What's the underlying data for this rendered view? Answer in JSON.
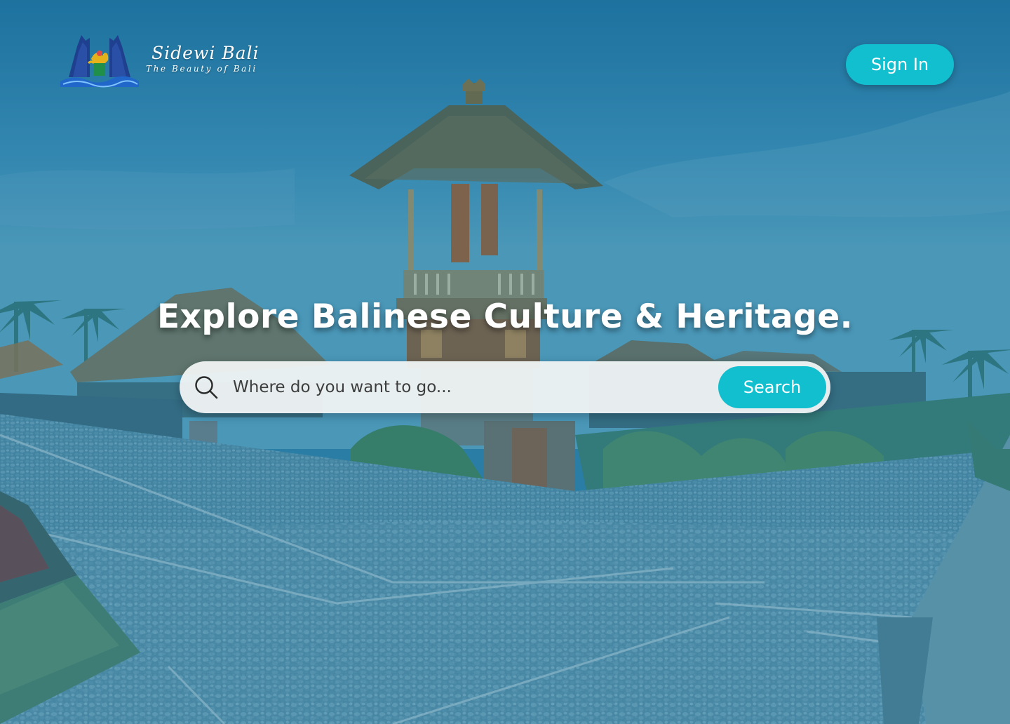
{
  "brand": {
    "name": "Sidewi Bali",
    "tagline": "The Beauty of Bali",
    "logo_icon": "split-gate-logo-icon"
  },
  "header": {
    "signin_label": "Sign In"
  },
  "hero": {
    "title": "Explore Balinese Culture & Heritage.",
    "background": "bali-village-temple-photo"
  },
  "search": {
    "icon": "search-icon",
    "placeholder": "Where do you want to go...",
    "value": "",
    "button_label": "Search"
  },
  "colors": {
    "accent": "#12bfcf",
    "overlay": "#2f7fa6",
    "text_light": "#ffffff",
    "search_field": "#eef2f3"
  }
}
